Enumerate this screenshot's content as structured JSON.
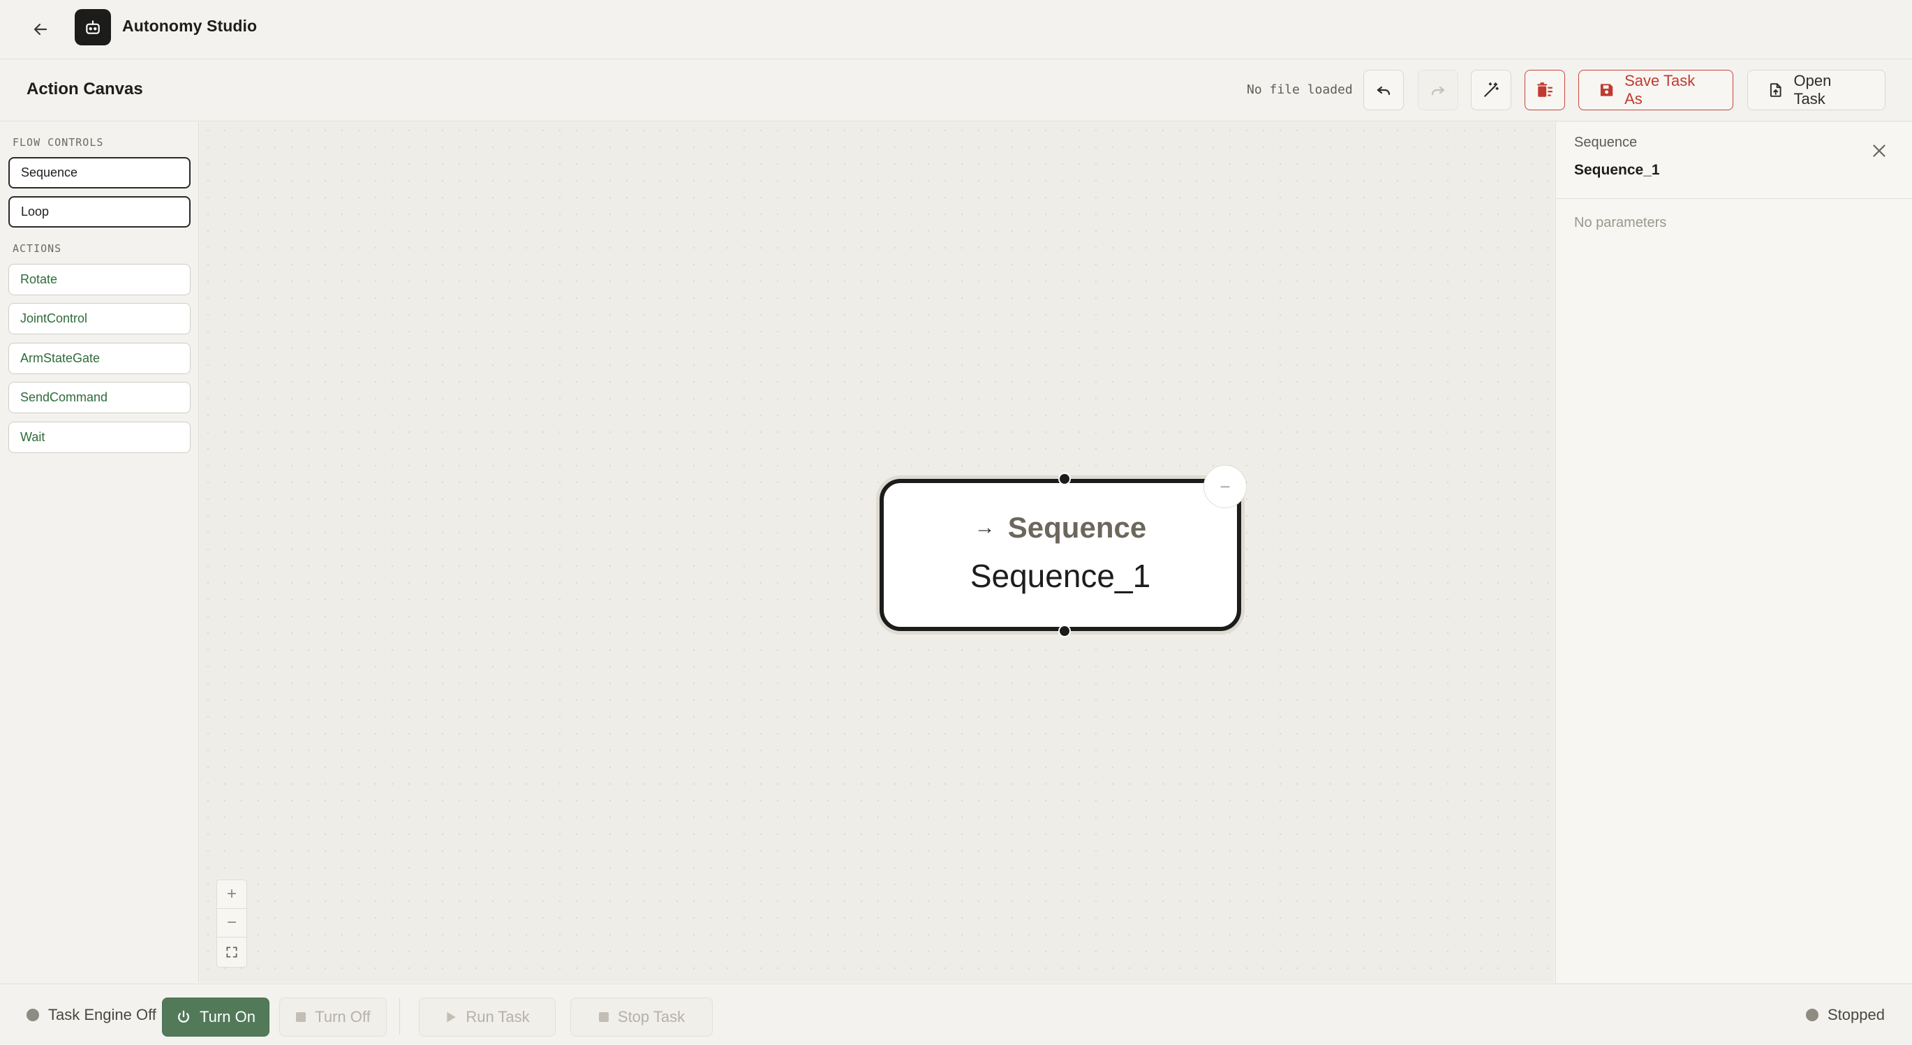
{
  "app": {
    "title": "Autonomy Studio",
    "back_icon": "arrow-left-icon",
    "logo_icon": "robot-icon"
  },
  "toolbar": {
    "canvas_title": "Action Canvas",
    "file_status": "No file loaded",
    "undo_icon": "undo-icon",
    "redo_icon": "redo-icon",
    "magic_icon": "magic-wand-icon",
    "clear_icon": "trash-list-icon",
    "save_label": "Save Task As",
    "open_label": "Open Task"
  },
  "sidebar": {
    "flow_label": "FLOW CONTROLS",
    "flow_items": [
      "Sequence",
      "Loop"
    ],
    "actions_label": "ACTIONS",
    "action_items": [
      "Rotate",
      "JointControl",
      "ArmStateGate",
      "SendCommand",
      "Wait"
    ]
  },
  "canvas": {
    "node": {
      "type_label": "Sequence",
      "name": "Sequence_1",
      "arrow": "→"
    },
    "collapse_symbol": "−",
    "zoom": {
      "in": "+",
      "out": "−"
    }
  },
  "inspector": {
    "type": "Sequence",
    "name": "Sequence_1",
    "empty_text": "No parameters"
  },
  "bottom": {
    "engine_status": "Task Engine Off",
    "turn_on": "Turn On",
    "turn_off": "Turn Off",
    "run_task": "Run Task",
    "stop_task": "Stop Task",
    "run_status": "Stopped"
  },
  "colors": {
    "accent_green": "#527a59",
    "danger_red": "#c2392f",
    "action_text_green": "#2f6b3a",
    "background": "#f3f2ee"
  }
}
